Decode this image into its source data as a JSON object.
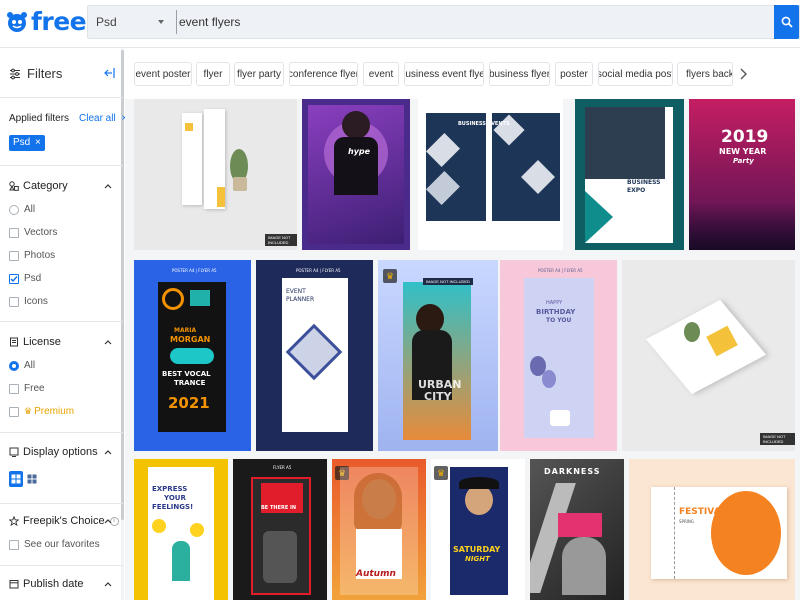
{
  "header": {
    "logo_text": "freepik",
    "search_type": "Psd",
    "search_query": "event flyers"
  },
  "sidebar": {
    "title": "Filters",
    "applied_filters_label": "Applied filters",
    "clear_all_label": "Clear all",
    "applied_tags": [
      "Psd"
    ],
    "category": {
      "title": "Category",
      "options": [
        "All",
        "Vectors",
        "Photos",
        "Psd",
        "Icons"
      ],
      "selected": "Psd"
    },
    "license": {
      "title": "License",
      "options": [
        "All",
        "Free",
        "Premium"
      ],
      "selected": "All"
    },
    "display_options": {
      "title": "Display options"
    },
    "freepiks_choice": {
      "title": "Freepik's Choice",
      "option": "See our favorites"
    },
    "publish_date": {
      "title": "Publish date"
    }
  },
  "tags": [
    "event poster",
    "flyer",
    "flyer party",
    "conference flyer",
    "event",
    "business event flyer",
    "business flyer",
    "poster",
    "social media post",
    "flyers backgro"
  ],
  "thumbnails": [
    {
      "name": "brochure-mockup",
      "texts": []
    },
    {
      "name": "purple-dj-flyer",
      "texts": [
        "hype"
      ]
    },
    {
      "name": "business-events-flyer",
      "texts": [
        "BUSINESS EVENTS"
      ]
    },
    {
      "name": "business-expo-flyer",
      "texts": [
        "BUSINESS",
        "EXPO"
      ]
    },
    {
      "name": "new-year-party-flyer",
      "texts": [
        "2019",
        "NEW YEAR",
        "Party"
      ]
    },
    {
      "name": "vocal-trance-poster",
      "texts": [
        "POSTER A4 | FLYER A5",
        "MARIA",
        "MORGAN",
        "BEST VOCAL",
        "TRANCE",
        "2021"
      ]
    },
    {
      "name": "event-planner-poster",
      "texts": [
        "POSTER A4 | FLYER A5",
        "EVENT",
        "PLANNER"
      ]
    },
    {
      "name": "urban-city-flyer",
      "texts": [
        "URBAN",
        "CITY"
      ]
    },
    {
      "name": "birthday-flyer",
      "texts": [
        "POSTER A4 | FLYER A5",
        "HAPPY",
        "BIRTHDAY",
        "TO YOU"
      ]
    },
    {
      "name": "trifold-mockup",
      "texts": []
    },
    {
      "name": "express-feelings-flyer",
      "texts": [
        "EXPRESS",
        "YOUR",
        "FEELINGS!"
      ]
    },
    {
      "name": "be-there-flyer",
      "texts": [
        "FLYER A5",
        "BE THERE IN"
      ]
    },
    {
      "name": "autumn-flyer",
      "texts": [
        "Autumn"
      ]
    },
    {
      "name": "saturday-night-flyer",
      "texts": [
        "SATURDAY",
        "NIGHT"
      ]
    },
    {
      "name": "darkness-poster",
      "texts": [
        "DARKNESS"
      ]
    },
    {
      "name": "festival-ticket",
      "texts": [
        "FESTIVAL",
        "SPRING"
      ]
    }
  ],
  "badges": {
    "image_not_included": "IMAGE NOT INCLUDED"
  },
  "colors": {
    "brand": "#1273eb",
    "premium": "#e6a300"
  }
}
